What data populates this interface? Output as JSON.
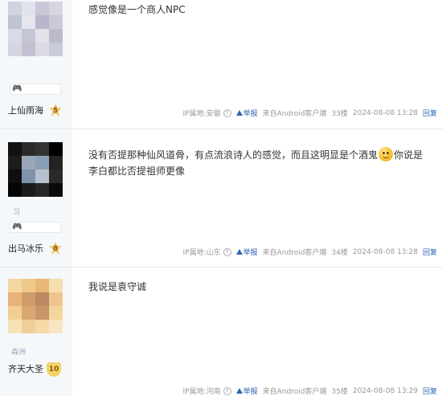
{
  "posts": [
    {
      "avatar": {
        "colors": [
          "#cfd3df",
          "#e1e2ea",
          "#c9c7d7",
          "#d9d4e2",
          "#bfc4d5",
          "#e6e7ee",
          "#b9b6cc",
          "#cbc9d8",
          "#d7dbe6",
          "#c6c5d6",
          "#e3e1ea",
          "#bcbacd",
          "#d3d6e1",
          "#c2c0d2",
          "#dcdbe5",
          "#c8cbd9"
        ]
      },
      "user": "上仙雨海",
      "level": "5",
      "content": "感觉像是一个商人NPC",
      "ip": "IP属地:安徽",
      "report": "举报",
      "source": "来自Android客户端",
      "floor": "33楼",
      "time": "2024-08-08 13:28",
      "reply": "回复"
    },
    {
      "avatar": {
        "colors": [
          "#111111",
          "#2b2b2b",
          "#333333",
          "#000000",
          "#1c1c1c",
          "#9aa7b6",
          "#8aa0b8",
          "#222222",
          "#0f0f0f",
          "#7e93aa",
          "#b7c1ce",
          "#2a2a2a",
          "#050505",
          "#1a1a1a",
          "#262626",
          "#0a0a0a"
        ]
      },
      "under": "习",
      "user": "出马冰乐",
      "level": "8",
      "content_a": "没有否提那种仙风道骨，有点流浪诗人的感觉，而且这明显是个酒鬼",
      "content_b": "你说是李白都比否提祖师更像",
      "ip": "IP属地:山东",
      "report": "举报",
      "source": "来自Android客户端",
      "floor": "34楼",
      "time": "2024-08-08 13:28",
      "reply": "回复"
    },
    {
      "avatar": {
        "colors": [
          "#f3d7a0",
          "#f0c98a",
          "#e9b878",
          "#f6deb0",
          "#e8b37a",
          "#cf9c6c",
          "#b98a64",
          "#eec58e",
          "#f1cf94",
          "#d9a774",
          "#c8956a",
          "#f4d59c",
          "#f7e2b8",
          "#f2cf98",
          "#f5d9a6",
          "#f8e6c2"
        ]
      },
      "under": "森洲",
      "user": "齐天大圣",
      "level": "10",
      "content": "我说是袁守诚",
      "ip": "IP属地:河南",
      "report": "举报",
      "source": "来自Android客户端",
      "floor": "35楼",
      "time": "2024-08-08 13:29",
      "reply": "回复"
    }
  ]
}
